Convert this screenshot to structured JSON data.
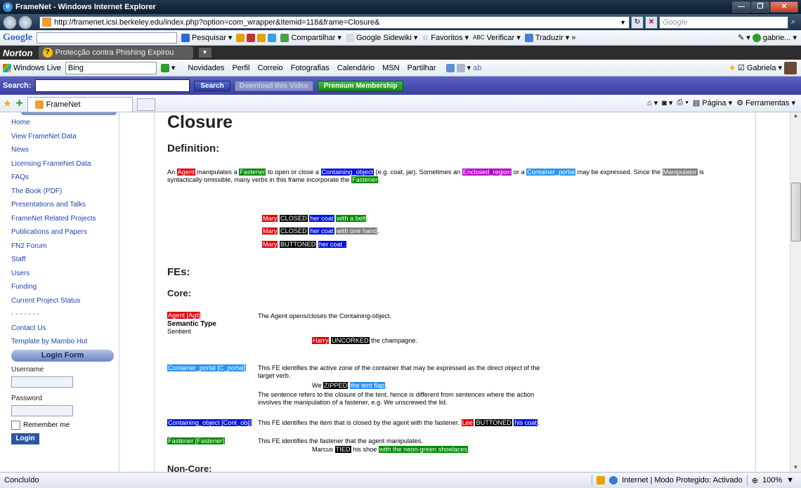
{
  "window": {
    "title": "FrameNet - Windows Internet Explorer"
  },
  "address": {
    "url": "http://framenet.icsi.berkeley.edu/index.php?option=com_wrapper&Itemid=118&frame=Closure&",
    "search_placeholder": "Google"
  },
  "google_toolbar": {
    "logo": "Google",
    "items": [
      "Pesquisar",
      "Compartilhar",
      "Google Sidewiki",
      "Favoritos",
      "Verificar",
      "Traduzir",
      "gabrie..."
    ]
  },
  "norton": {
    "logo": "Norton",
    "warning": "Protecção contra Phishing Expirou"
  },
  "live_toolbar": {
    "logo": "Windows Live",
    "search_value": "Bing",
    "links": [
      "Novidades",
      "Perfil",
      "Correio",
      "Fotografias",
      "Calendário",
      "MSN",
      "Partilhar"
    ],
    "user": "Gabriela"
  },
  "search_toolbar": {
    "label": "Search:",
    "search_btn": "Search",
    "download_btn": "Download this Video",
    "premium_btn": "Premium Membership"
  },
  "tabs": {
    "active": "FrameNet",
    "commands": [
      "Página",
      "Ferramentas"
    ]
  },
  "sidebar": {
    "links": [
      "Home",
      "View FrameNet Data",
      "News",
      "Licensing FrameNet Data",
      "FAQs",
      "The Book (PDF)",
      "Presentations and Talks",
      "FrameNet Related Projects",
      "Publications and Papers",
      "FN2 Forum",
      "Staff",
      "Users",
      "Funding",
      "Current Project Status",
      "- - - - - - -",
      "Contact Us",
      "Template by Mambo Hut"
    ],
    "login_header": "Login Form",
    "username_label": "Username",
    "password_label": "Password",
    "remember_label": "Remember me",
    "login_btn": "Login"
  },
  "page": {
    "title": "Closure",
    "definition_heading": "Definition:",
    "def": {
      "t1": "An ",
      "agent": "Agent",
      "t2": " manipulates a ",
      "fastener": "Fastener",
      "t3": " to open or close a ",
      "containing_object": "Containing_object",
      "t4": " (e.g. coat, jar). Sometimes an ",
      "enclosed_region": "Enclosed_region",
      "t5": " or a ",
      "container_portal": "Container_portal",
      "t6": " may be expressed. Since the ",
      "manipulator": "Manipulator",
      "t7": " is",
      "line2": "syntactically omissible, many verbs in this frame incorporate the ",
      "fastener2": "Fastener",
      "t8": "."
    },
    "examples": [
      {
        "a": "Mary",
        "v": "CLOSED",
        "o": "her coat",
        "f": "with a belt",
        "end": "."
      },
      {
        "a": "Mary",
        "v": "CLOSED",
        "o": "her coat",
        "f": "with one hand",
        "end": "."
      },
      {
        "a": "Mary",
        "v": "BUTTONED",
        "o": "her coat .",
        "f": "",
        "end": ""
      }
    ],
    "fes_heading": "FEs:",
    "core_heading": "Core:",
    "agent_fe": {
      "label": "Agent [Agt]",
      "semtype_label": "Semantic Type",
      "semtype": "Sentient",
      "desc": "The Agent opens/closes the Containing-object.",
      "ex_a": "Harry",
      "ex_v": "UNCORKED",
      "ex_rest": " the champagne."
    },
    "portal_fe": {
      "label": "Container_portal [C_portal]",
      "desc1": "This FE identifies the active zone of the container that may be expressed as the direct object of the",
      "desc2": "target verb.",
      "ex_pre": "We ",
      "ex_v": "ZIPPED",
      "ex_o": "the tent flap",
      "ex_end": ".",
      "note1": "The sentence refers to the closure of the tent, hence is different from sentences where the action",
      "note2": "involves the manipulation of a fastener, e.g. We unscrewed the lid."
    },
    "obj_fe": {
      "label": "Containing_object [Cont_obj]",
      "desc": "This FE identifies the item that is closed by the agent with the fastener. ",
      "ex_a": "Lee",
      "ex_v": "BUTTONED",
      "ex_o": "his coat",
      "ex_end": "."
    },
    "fast_fe": {
      "label": "Fastener [Fastener]",
      "desc": "This FE identifies the fastener that the agent manipulates.",
      "ex_pre": "Marcus ",
      "ex_v": "TIED",
      "ex_mid": " his shoe ",
      "ex_f": "with the neon-green shoelaces",
      "ex_end": "."
    },
    "noncore_heading": "Non-Core:"
  },
  "status": {
    "left": "Concluído",
    "zone": "Internet | Modo Protegido: Activado",
    "zoom": "100%"
  },
  "colors": {
    "agent": "#e0000d",
    "fastener": "#008a00",
    "object": "#0011dd",
    "region": "#b500c8",
    "portal": "#2794f5",
    "manipulator": "#7d7d7d",
    "target": "#000000"
  }
}
